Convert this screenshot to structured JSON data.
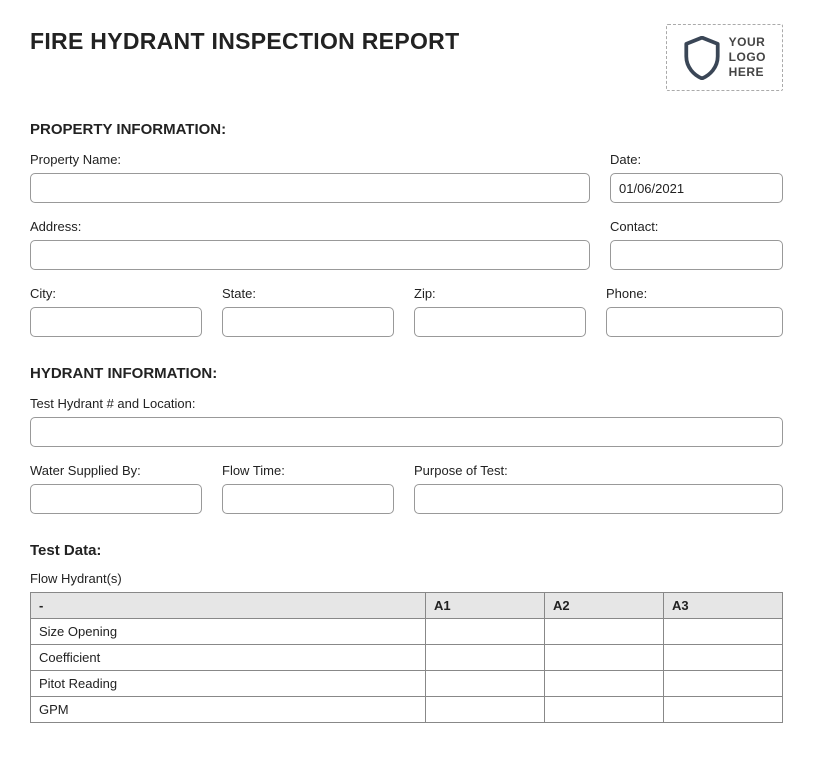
{
  "report": {
    "title": "FIRE HYDRANT INSPECTION REPORT",
    "logo_placeholder": "YOUR\nLOGO\nHERE"
  },
  "property_info": {
    "heading": "PROPERTY INFORMATION:",
    "property_name": {
      "label": "Property Name:",
      "value": ""
    },
    "date": {
      "label": "Date:",
      "value": "01/06/2021"
    },
    "address": {
      "label": "Address:",
      "value": ""
    },
    "contact": {
      "label": "Contact:",
      "value": ""
    },
    "city": {
      "label": "City:",
      "value": ""
    },
    "state": {
      "label": "State:",
      "value": ""
    },
    "zip": {
      "label": "Zip:",
      "value": ""
    },
    "phone": {
      "label": "Phone:",
      "value": ""
    }
  },
  "hydrant_info": {
    "heading": "HYDRANT INFORMATION:",
    "test_hydrant": {
      "label": "Test Hydrant # and Location:",
      "value": ""
    },
    "water_supplied_by": {
      "label": "Water Supplied By:",
      "value": ""
    },
    "flow_time": {
      "label": "Flow Time:",
      "value": ""
    },
    "purpose": {
      "label": "Purpose of Test:",
      "value": ""
    }
  },
  "test_data": {
    "heading": "Test Data:",
    "caption": "Flow Hydrant(s)",
    "columns": [
      "-",
      "A1",
      "A2",
      "A3"
    ],
    "rows": [
      {
        "label": "Size Opening",
        "a1": "",
        "a2": "",
        "a3": ""
      },
      {
        "label": "Coefficient",
        "a1": "",
        "a2": "",
        "a3": ""
      },
      {
        "label": "Pitot Reading",
        "a1": "",
        "a2": "",
        "a3": ""
      },
      {
        "label": "GPM",
        "a1": "",
        "a2": "",
        "a3": ""
      }
    ]
  }
}
